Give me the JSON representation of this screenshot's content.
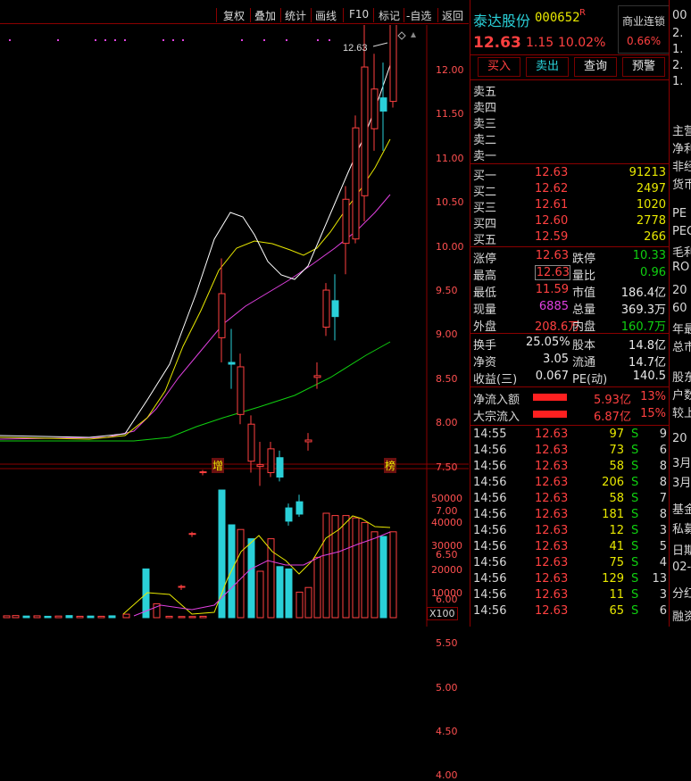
{
  "toolbar": {
    "items": [
      "复权",
      "叠加",
      "统计",
      "画线",
      "F10",
      "标记",
      "-自选",
      "返回"
    ]
  },
  "chart": {
    "high_label": "12.63",
    "price_ticks": [
      "12.00",
      "11.50",
      "11.00",
      "10.50",
      "10.00",
      "9.50",
      "9.00",
      "8.50",
      "8.00",
      "7.50",
      "7.00",
      "6.50",
      "6.00",
      "5.50",
      "5.00",
      "4.50",
      "4.00"
    ],
    "marker_zeng": "增",
    "marker_bang": "榜",
    "volume_ticks": [
      "50000",
      "40000",
      "30000",
      "20000",
      "10000"
    ],
    "volume_unit": "X100"
  },
  "stock": {
    "name": "泰达股份",
    "code": "000652",
    "flag": "R",
    "price": "12.63",
    "change": "1.15",
    "change_pct": "10.02%",
    "sector_name": "商业连锁",
    "sector_pct": "0.66%"
  },
  "actions": {
    "buy": "买入",
    "sell": "卖出",
    "query": "查询",
    "alert": "预警"
  },
  "order_book": {
    "sells": [
      {
        "label": "卖五",
        "price": "",
        "vol": ""
      },
      {
        "label": "卖四",
        "price": "",
        "vol": ""
      },
      {
        "label": "卖三",
        "price": "",
        "vol": ""
      },
      {
        "label": "卖二",
        "price": "",
        "vol": ""
      },
      {
        "label": "卖一",
        "price": "",
        "vol": ""
      }
    ],
    "buys": [
      {
        "label": "买一",
        "price": "12.63",
        "vol": "91213"
      },
      {
        "label": "买二",
        "price": "12.62",
        "vol": "2497"
      },
      {
        "label": "买三",
        "price": "12.61",
        "vol": "1020"
      },
      {
        "label": "买四",
        "price": "12.60",
        "vol": "2778"
      },
      {
        "label": "买五",
        "price": "12.59",
        "vol": "266"
      }
    ]
  },
  "stats": [
    {
      "l1": "涨停",
      "v1": "12.63",
      "c1": "red",
      "l2": "跌停",
      "v2": "10.33",
      "c2": "green"
    },
    {
      "l1": "最高",
      "v1": "12.63",
      "c1": "red",
      "l2": "量比",
      "v2": "0.96",
      "c2": "green"
    },
    {
      "l1": "最低",
      "v1": "11.59",
      "c1": "red",
      "l2": "市值",
      "v2": "186.4亿",
      "c2": "white"
    },
    {
      "l1": "现量",
      "v1": "6885",
      "c1": "purple",
      "l2": "总量",
      "v2": "369.3万",
      "c2": "white"
    },
    {
      "l1": "外盘",
      "v1": "208.6万",
      "c1": "red",
      "l2": "内盘",
      "v2": "160.7万",
      "c2": "green"
    }
  ],
  "stats2": [
    {
      "l1": "换手",
      "v1": "25.05%",
      "l2": "股本",
      "v2": "14.8亿"
    },
    {
      "l1": "净资",
      "v1": "3.05",
      "l2": "流通",
      "v2": "14.7亿"
    },
    {
      "l1": "收益(三)",
      "v1": "0.067",
      "l2": "PE(动)",
      "v2": "140.5"
    }
  ],
  "flows": [
    {
      "label": "净流入额",
      "value": "5.93亿",
      "pct": "13%"
    },
    {
      "label": "大宗流入",
      "value": "6.87亿",
      "pct": "15%"
    }
  ],
  "ticks": [
    {
      "time": "14:55",
      "price": "12.63",
      "vol": "97",
      "side": "S",
      "n": "9"
    },
    {
      "time": "14:56",
      "price": "12.63",
      "vol": "73",
      "side": "S",
      "n": "6"
    },
    {
      "time": "14:56",
      "price": "12.63",
      "vol": "58",
      "side": "S",
      "n": "8"
    },
    {
      "time": "14:56",
      "price": "12.63",
      "vol": "206",
      "side": "S",
      "n": "8"
    },
    {
      "time": "14:56",
      "price": "12.63",
      "vol": "58",
      "side": "S",
      "n": "7"
    },
    {
      "time": "14:56",
      "price": "12.63",
      "vol": "181",
      "side": "S",
      "n": "8"
    },
    {
      "time": "14:56",
      "price": "12.63",
      "vol": "12",
      "side": "S",
      "n": "3"
    },
    {
      "time": "14:56",
      "price": "12.63",
      "vol": "41",
      "side": "S",
      "n": "5"
    },
    {
      "time": "14:56",
      "price": "12.63",
      "vol": "75",
      "side": "S",
      "n": "4"
    },
    {
      "time": "14:56",
      "price": "12.63",
      "vol": "129",
      "side": "S",
      "n": "13"
    },
    {
      "time": "14:56",
      "price": "12.63",
      "vol": "11",
      "side": "S",
      "n": "3"
    },
    {
      "time": "14:56",
      "price": "12.63",
      "vol": "65",
      "side": "S",
      "n": "6"
    }
  ],
  "farright": [
    "00",
    "2.",
    "1.",
    "2.",
    "1.",
    "主营",
    "净利",
    "非经",
    "货币",
    "PE",
    "PEG",
    "毛利",
    "RO",
    "20",
    "60",
    "年最",
    "总市",
    "股东",
    "户数",
    "较上",
    "20",
    "3月",
    "3月",
    "基金",
    "私募",
    "日期",
    "02-",
    "分红",
    "融资"
  ],
  "colors": {
    "up": "#ff4040",
    "down": "#2ad0d8",
    "ma5": "#ffffff",
    "ma10": "#e8e800",
    "ma20": "#e040e0",
    "ma60": "#10d010",
    "border": "#8b0000"
  }
}
